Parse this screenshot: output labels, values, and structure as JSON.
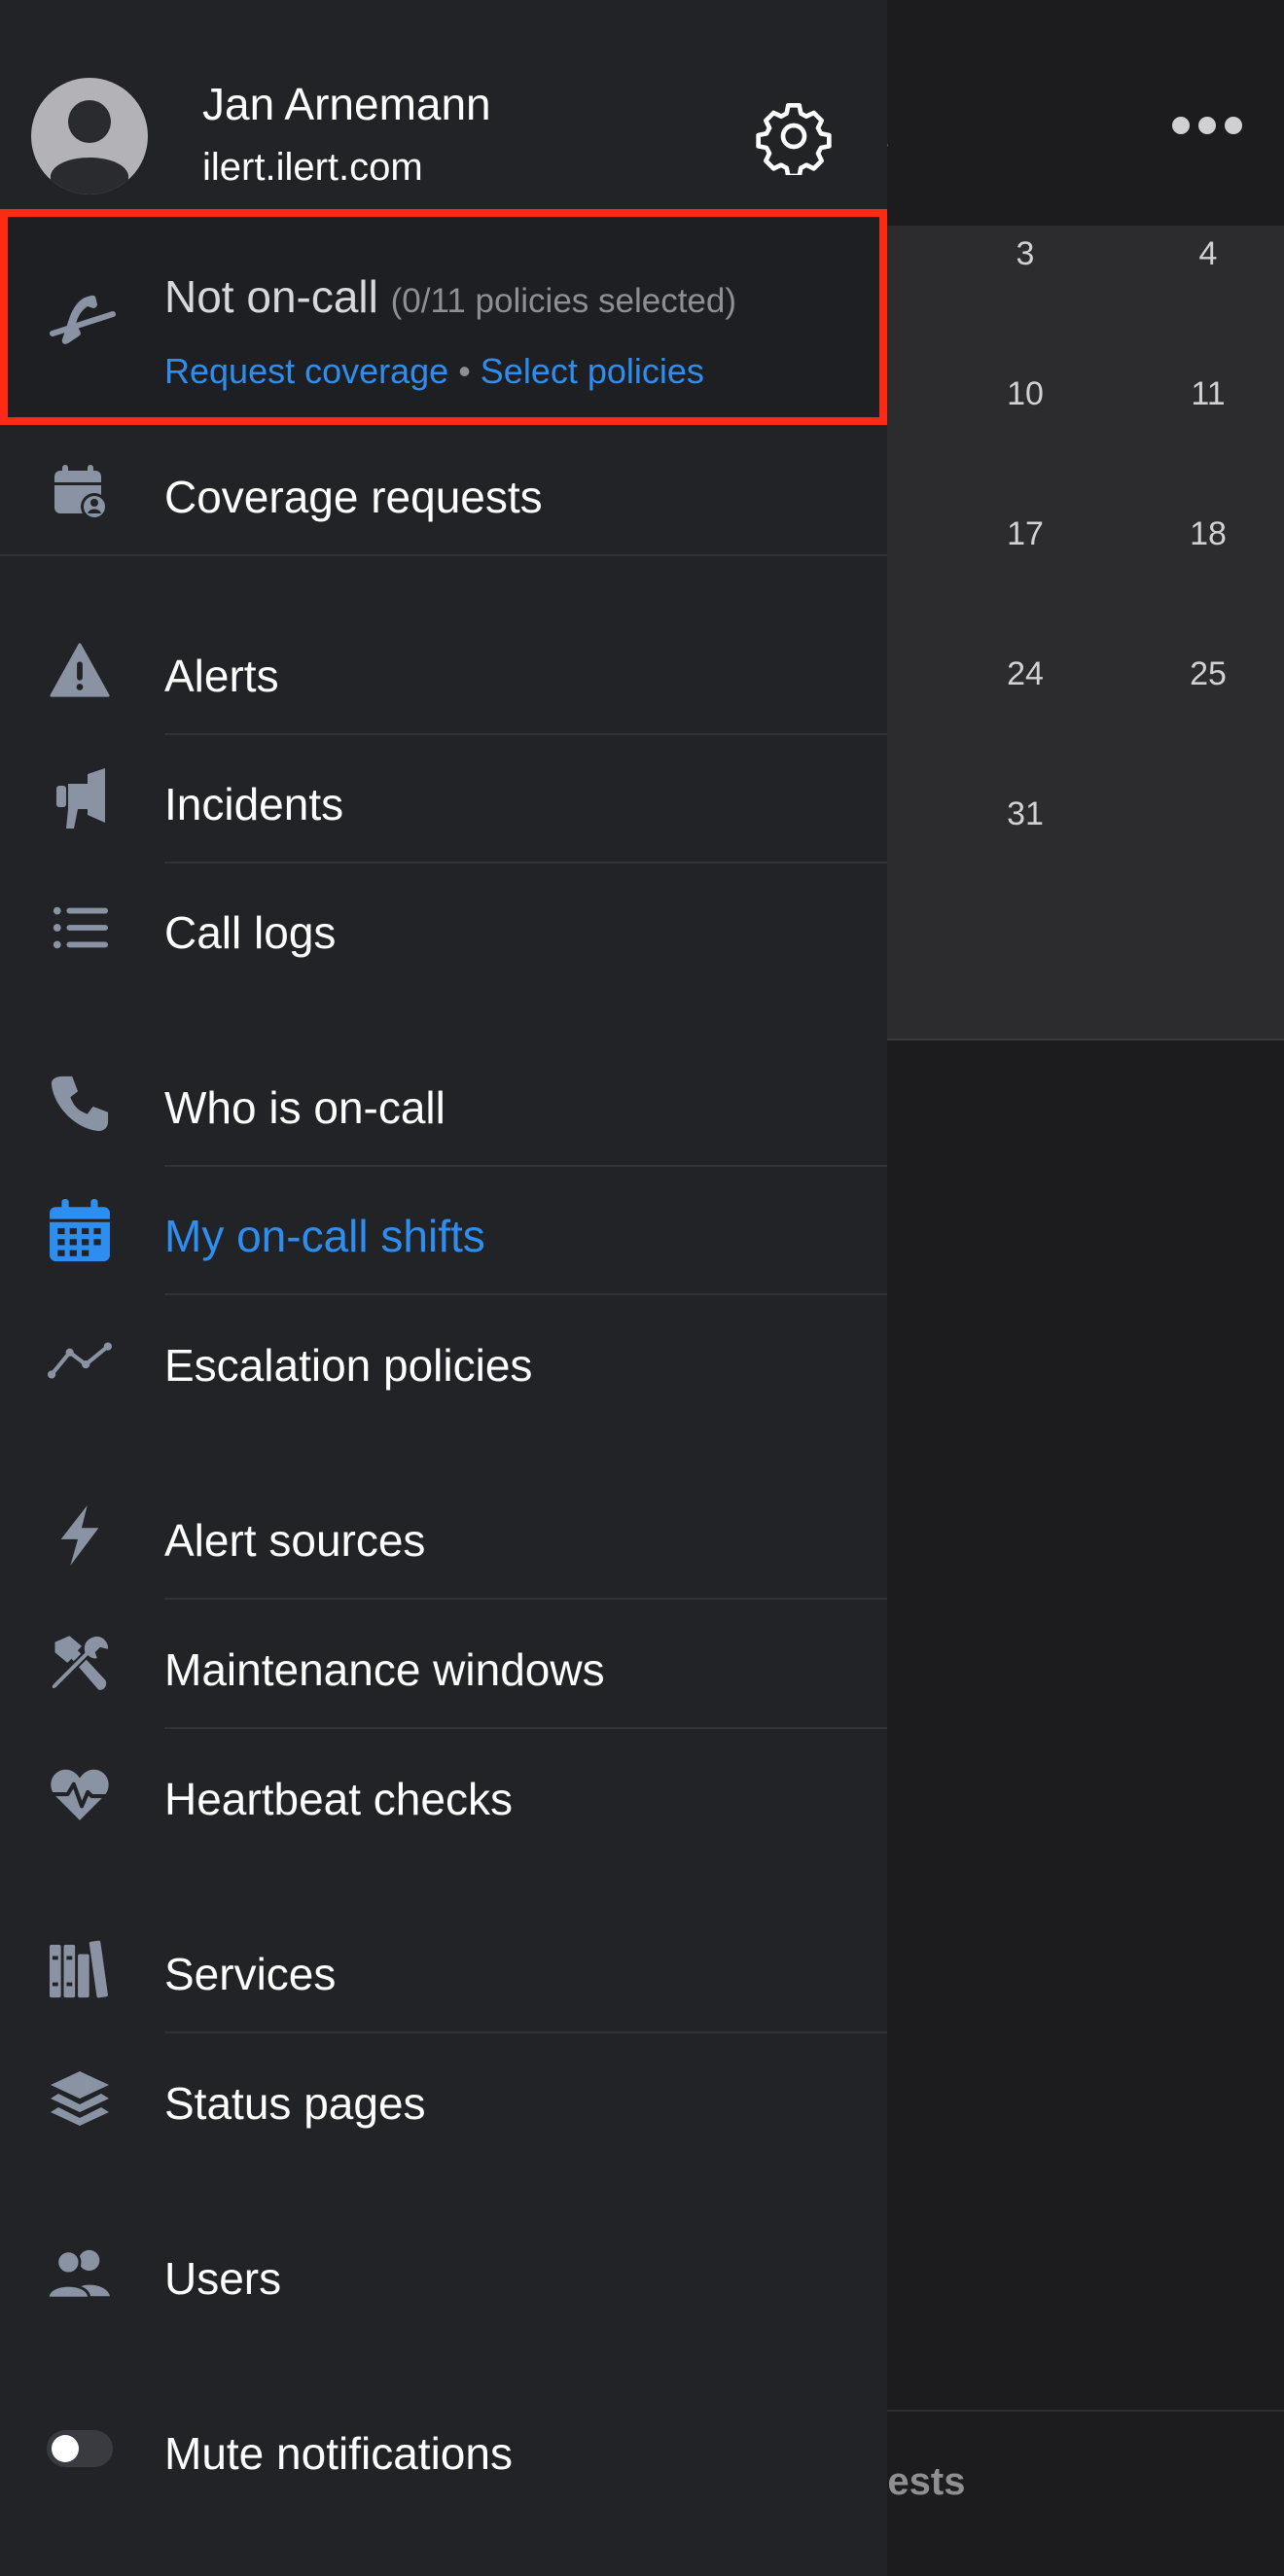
{
  "background": {
    "calendar_days": [
      "3",
      "4",
      "10",
      "11",
      "17",
      "18",
      "24",
      "25",
      "31"
    ],
    "bottom_tab_fragment": "uests"
  },
  "profile": {
    "name": "Jan Arnemann",
    "domain": "ilert.ilert.com"
  },
  "oncall": {
    "status": "Not on-call",
    "policies": "(0/11 policies selected)",
    "request_coverage": "Request coverage",
    "separator": "•",
    "select_policies": "Select policies",
    "highlight_color": "#ff2a12"
  },
  "menu": {
    "coverage_requests": "Coverage requests",
    "alerts": "Alerts",
    "incidents": "Incidents",
    "call_logs": "Call logs",
    "who_is_oncall": "Who is on-call",
    "my_oncall_shifts": "My on-call shifts",
    "escalation_policies": "Escalation policies",
    "alert_sources": "Alert sources",
    "maintenance_windows": "Maintenance windows",
    "heartbeat_checks": "Heartbeat checks",
    "services": "Services",
    "status_pages": "Status pages",
    "users": "Users",
    "mute_notifications": "Mute notifications"
  },
  "colors": {
    "accent": "#2e8ef0",
    "icon": "#8a93a3",
    "drawer_bg": "#222327"
  },
  "icons": {
    "settings": "gear-icon",
    "oncall": "phone-off-icon",
    "coverage": "calendar-user-icon",
    "alerts": "warning-triangle-icon",
    "incidents": "megaphone-icon",
    "call_logs": "list-icon",
    "who_is_oncall": "phone-icon",
    "my_shifts": "calendar-icon",
    "escalation": "line-chart-icon",
    "alert_sources": "bolt-icon",
    "maintenance": "tools-icon",
    "heartbeat": "heartbeat-icon",
    "services": "books-icon",
    "status_pages": "layers-icon",
    "users": "users-icon"
  },
  "mute_toggle_on": false
}
